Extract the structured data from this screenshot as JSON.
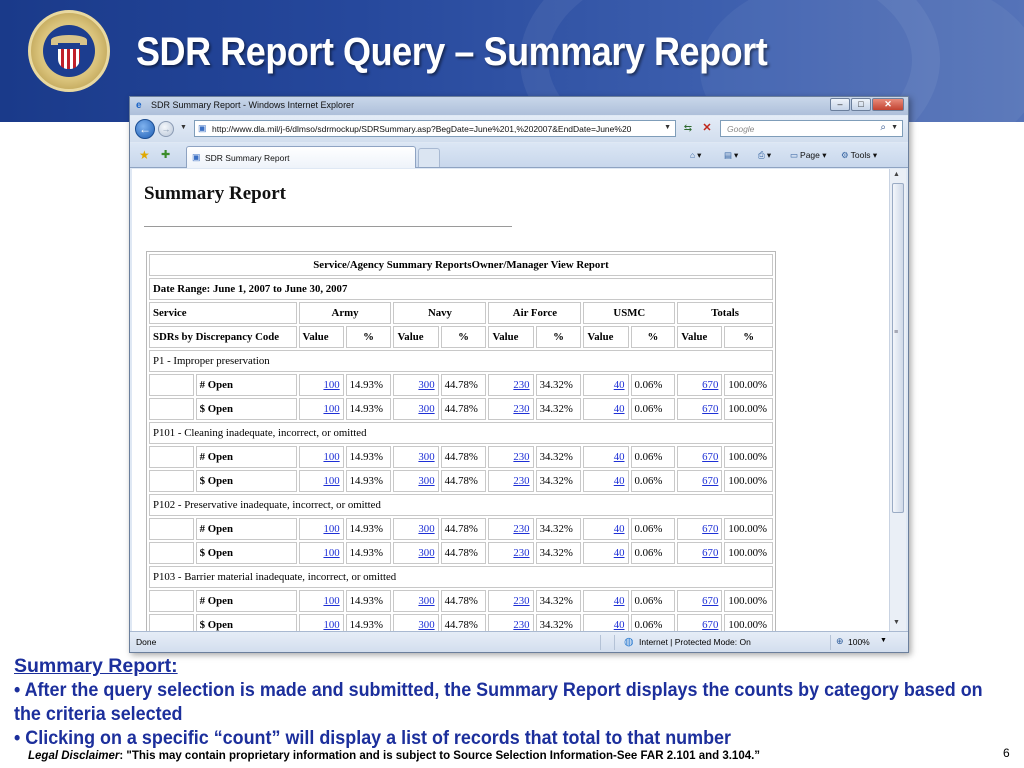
{
  "slide": {
    "title": "SDR Report Query – Summary Report",
    "page_number": "6"
  },
  "browser": {
    "window_title": "SDR Summary Report - Windows Internet Explorer",
    "url": "http://www.dla.mil/j-6/dlmso/sdrmockup/SDRSummary.asp?BegDate=June%201,%202007&EndDate=June%20",
    "search_placeholder": "Google",
    "tab_label": "SDR Summary Report",
    "commands": {
      "page": "Page",
      "tools": "Tools"
    },
    "status": {
      "left": "Done",
      "zone": "Internet | Protected Mode: On",
      "zoom": "100%"
    }
  },
  "report": {
    "title": "Summary Report",
    "table_caption": "Service/Agency Summary ReportsOwner/Manager View Report",
    "date_range": "Date Range: June 1, 2007 to June 30, 2007",
    "service_label": "Service",
    "services": [
      "Army",
      "Navy",
      "Air Force",
      "USMC",
      "Totals"
    ],
    "sub_header": {
      "label": "SDRs by Discrepancy Code",
      "value": "Value",
      "percent": "%"
    },
    "codes": [
      {
        "name": "P1 - Improper preservation",
        "rows": [
          {
            "label": "# Open",
            "cells": [
              [
                "100",
                "14.93%"
              ],
              [
                "300",
                "44.78%"
              ],
              [
                "230",
                "34.32%"
              ],
              [
                "40",
                "0.06%"
              ],
              [
                "670",
                "100.00%"
              ]
            ]
          },
          {
            "label": "$ Open",
            "cells": [
              [
                "100",
                "14.93%"
              ],
              [
                "300",
                "44.78%"
              ],
              [
                "230",
                "34.32%"
              ],
              [
                "40",
                "0.06%"
              ],
              [
                "670",
                "100.00%"
              ]
            ]
          }
        ]
      },
      {
        "name": "P101 - Cleaning inadequate, incorrect, or omitted",
        "rows": [
          {
            "label": "# Open",
            "cells": [
              [
                "100",
                "14.93%"
              ],
              [
                "300",
                "44.78%"
              ],
              [
                "230",
                "34.32%"
              ],
              [
                "40",
                "0.06%"
              ],
              [
                "670",
                "100.00%"
              ]
            ]
          },
          {
            "label": "$ Open",
            "cells": [
              [
                "100",
                "14.93%"
              ],
              [
                "300",
                "44.78%"
              ],
              [
                "230",
                "34.32%"
              ],
              [
                "40",
                "0.06%"
              ],
              [
                "670",
                "100.00%"
              ]
            ]
          }
        ]
      },
      {
        "name": "P102 - Preservative inadequate, incorrect, or omitted",
        "rows": [
          {
            "label": "# Open",
            "cells": [
              [
                "100",
                "14.93%"
              ],
              [
                "300",
                "44.78%"
              ],
              [
                "230",
                "34.32%"
              ],
              [
                "40",
                "0.06%"
              ],
              [
                "670",
                "100.00%"
              ]
            ]
          },
          {
            "label": "$ Open",
            "cells": [
              [
                "100",
                "14.93%"
              ],
              [
                "300",
                "44.78%"
              ],
              [
                "230",
                "34.32%"
              ],
              [
                "40",
                "0.06%"
              ],
              [
                "670",
                "100.00%"
              ]
            ]
          }
        ]
      },
      {
        "name": "P103 - Barrier material inadequate, incorrect, or omitted",
        "rows": [
          {
            "label": "# Open",
            "cells": [
              [
                "100",
                "14.93%"
              ],
              [
                "300",
                "44.78%"
              ],
              [
                "230",
                "34.32%"
              ],
              [
                "40",
                "0.06%"
              ],
              [
                "670",
                "100.00%"
              ]
            ]
          },
          {
            "label": "$ Open",
            "cells": [
              [
                "100",
                "14.93%"
              ],
              [
                "300",
                "44.78%"
              ],
              [
                "230",
                "34.32%"
              ],
              [
                "40",
                "0.06%"
              ],
              [
                "670",
                "100.00%"
              ]
            ]
          }
        ]
      }
    ]
  },
  "notes": {
    "heading": "Summary Report:",
    "points": [
      "• After the query selection is made and submitted, the Summary Report displays the counts by category based on the criteria selected",
      "• Clicking on a specific “count” will display a list of records that total to that number"
    ]
  },
  "disclaimer": {
    "label": "Legal Disclaimer",
    "text": ":  \"This may contain proprietary information and is subject to Source Selection Information-See FAR 2.101 and 3.104.”"
  },
  "colors": {
    "header_blue": "#26489c",
    "note_blue": "#1c2f9c",
    "link_blue": "#1d2fd6"
  },
  "icons": [
    "dla-seal-logo",
    "ie-icon",
    "back-arrow-icon",
    "forward-arrow-icon",
    "refresh-icon",
    "stop-icon",
    "search-icon",
    "favorites-star-icon",
    "add-favorites-icon",
    "home-icon",
    "feeds-icon",
    "print-icon",
    "page-icon",
    "tools-icon",
    "globe-icon",
    "zoom-icon"
  ]
}
